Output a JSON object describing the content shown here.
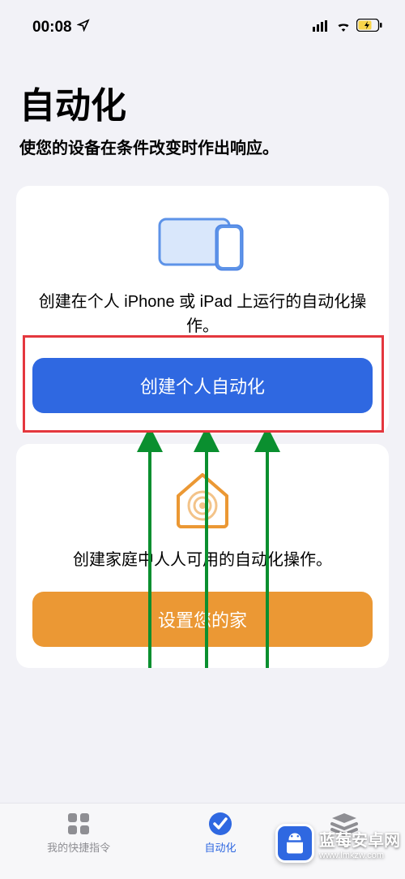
{
  "status": {
    "time": "00:08"
  },
  "header": {
    "title": "自动化",
    "subtitle": "使您的设备在条件改变时作出响应。"
  },
  "cards": {
    "personal": {
      "description": "创建在个人 iPhone 或 iPad 上运行的自动化操作。",
      "button": "创建个人自动化"
    },
    "home": {
      "description": "创建家庭中人人可用的自动化操作。",
      "button": "设置您的家"
    }
  },
  "tabs": {
    "shortcuts": "我的快捷指令",
    "automation": "自动化",
    "gallery": ""
  },
  "watermark": "蓝莓安卓网",
  "watermark_url": "www.lmkzw.com"
}
